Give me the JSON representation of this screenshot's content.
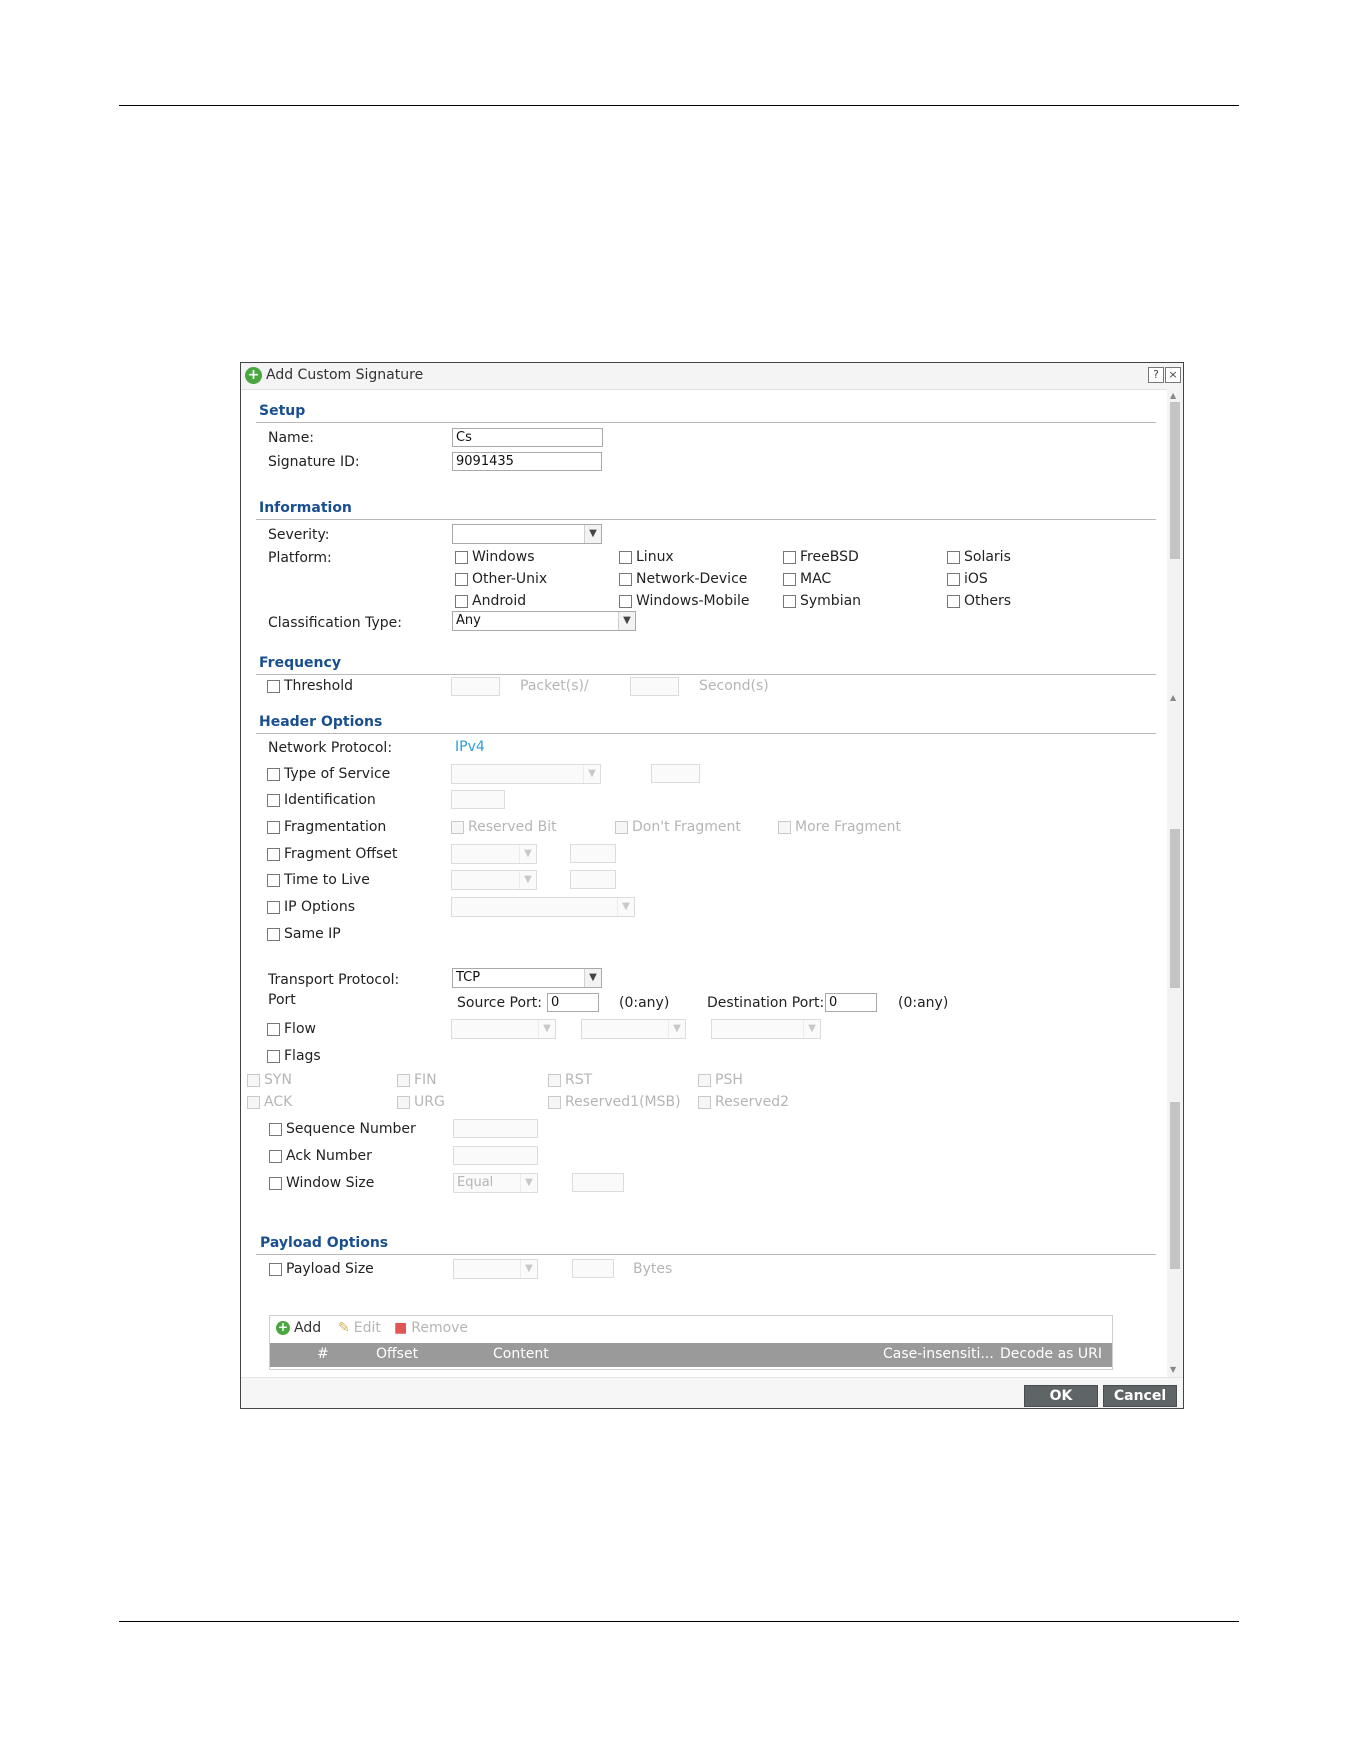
{
  "dialog": {
    "title": "Add Custom Signature",
    "help_glyph": "?",
    "close_glyph": "×",
    "ok_label": "OK",
    "cancel_label": "Cancel",
    "icon": "plus-circle-icon"
  },
  "setup": {
    "title": "Setup",
    "name_label": "Name:",
    "name_value": "Cs",
    "sigid_label": "Signature ID:",
    "sigid_value": "9091435"
  },
  "information": {
    "title": "Information",
    "severity_label": "Severity:",
    "severity_value": "",
    "platform_label": "Platform:",
    "platforms": [
      "Windows",
      "Linux",
      "FreeBSD",
      "Solaris",
      "Other-Unix",
      "Network-Device",
      "MAC",
      "iOS",
      "Android",
      "Windows-Mobile",
      "Symbian",
      "Others"
    ],
    "classification_label": "Classification Type:",
    "classification_value": "Any"
  },
  "frequency": {
    "title": "Frequency",
    "threshold_label": "Threshold",
    "packets_label": "Packet(s)/",
    "seconds_label": "Second(s)"
  },
  "header_options": {
    "title": "Header Options",
    "network_protocol_label": "Network Protocol:",
    "network_protocol_value": "IPv4",
    "type_of_service": "Type of Service",
    "identification": "Identification",
    "fragmentation": "Fragmentation",
    "reserved_bit": "Reserved Bit",
    "dont_fragment": "Don't Fragment",
    "more_fragment": "More Fragment",
    "fragment_offset": "Fragment Offset",
    "time_to_live": "Time to Live",
    "ip_options": "IP Options",
    "same_ip": "Same IP",
    "transport_protocol_label": "Transport Protocol:",
    "transport_protocol_value": "TCP",
    "port_label": "Port",
    "source_port_label": "Source Port:",
    "source_port_value": "0",
    "source_any": "(0:any)",
    "dest_port_label": "Destination Port:",
    "dest_port_value": "0",
    "dest_any": "(0:any)",
    "flow": "Flow",
    "flags": "Flags",
    "flag_items": [
      "SYN",
      "FIN",
      "RST",
      "PSH",
      "ACK",
      "URG",
      "Reserved1(MSB)",
      "Reserved2"
    ],
    "sequence_number": "Sequence Number",
    "ack_number": "Ack Number",
    "window_size": "Window Size",
    "window_size_op": "Equal"
  },
  "payload_options": {
    "title": "Payload Options",
    "payload_size": "Payload Size",
    "bytes_label": "Bytes",
    "add_label": "Add",
    "edit_label": "Edit",
    "remove_label": "Remove",
    "columns": [
      "#",
      "Offset",
      "Content",
      "Case-insensiti...",
      "Decode as URI"
    ]
  },
  "colors": {
    "section_title": "#1a4f8f",
    "link": "#2b9ed8",
    "add_green": "#4aa63f",
    "remove_red": "#e05555",
    "button_bg": "#5f6466"
  }
}
